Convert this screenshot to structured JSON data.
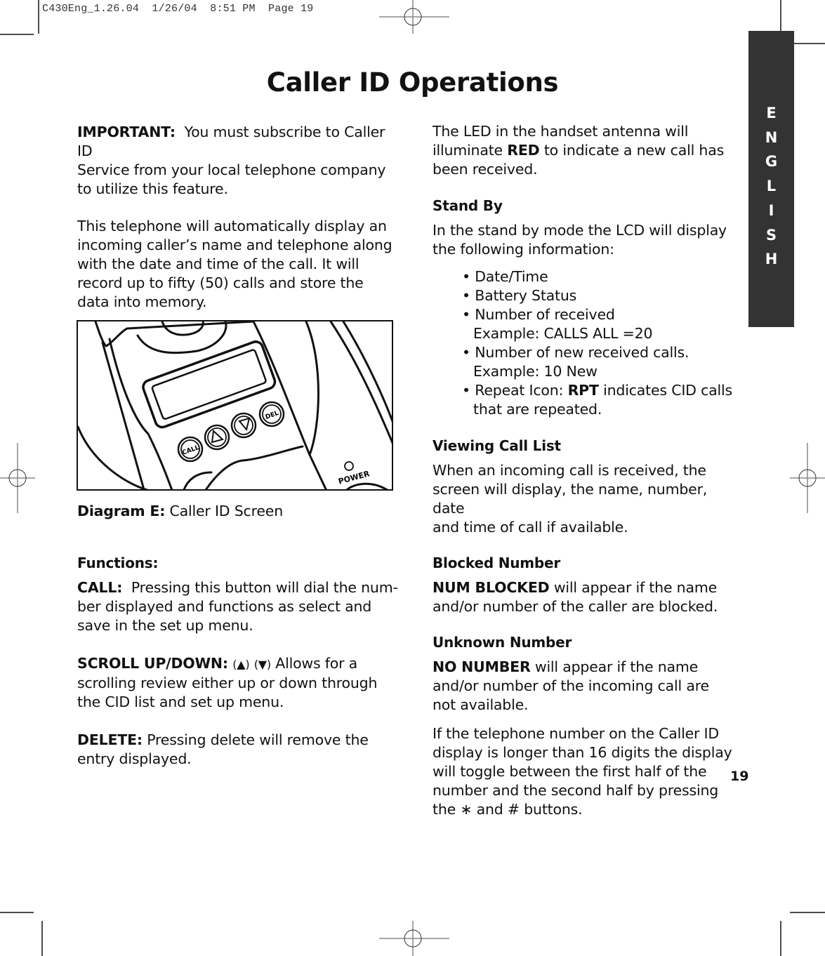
{
  "slug": "C430Eng_1.26.04  1/26/04  8:51 PM  Page 19",
  "title": "Caller ID Operations",
  "side_tab": {
    "letters": [
      "E",
      "N",
      "G",
      "L",
      "I",
      "S",
      "H"
    ],
    "color": "#333333"
  },
  "page_number": "19",
  "left_column": {
    "important": {
      "label": "IMPORTANT:",
      "lines": [
        "You must subscribe to Caller ID",
        "Service from your local telephone company",
        "to utilize this feature."
      ]
    },
    "intro_lines": [
      "This telephone will automatically display an",
      "incoming caller’s name and telephone along",
      "with the date and time of the call. It will",
      "record up to fifty (50) calls and store the",
      "data into memory."
    ],
    "diagram": {
      "button_labels": {
        "call": "CALL",
        "del": "DEL",
        "power": "POWER"
      },
      "caption_label": "Diagram E:",
      "caption_text": "Caller ID Screen"
    },
    "functions_heading": "Functions:",
    "call": {
      "label": "CALL:",
      "lines": [
        "Pressing this button will dial the num-",
        "ber displayed and functions as select and",
        "save in the set up menu."
      ]
    },
    "scroll": {
      "label": "SCROLL UP/DOWN:",
      "up_symbol": "(▲)",
      "down_symbol": "(▼)",
      "lines": [
        "Allows for a",
        "scrolling review either up or down through",
        "the CID list and set up menu."
      ]
    },
    "delete": {
      "label": "DELETE:",
      "lines": [
        "Pressing delete will remove the",
        "entry displayed."
      ]
    }
  },
  "right_column": {
    "led": {
      "line1": "The LED in the handset antenna will",
      "line2_before": "illuminate",
      "line2_bold": "RED",
      "line2_after": "to indicate a new call has",
      "line3": "been received."
    },
    "standby": {
      "heading": "Stand By",
      "lines": [
        "In the stand by mode the LCD will display",
        "the following information:"
      ],
      "bullets": [
        {
          "text": "Date/Time"
        },
        {
          "text": "Battery Status"
        },
        {
          "text": "Number of received",
          "sub": "Example: CALLS ALL =20"
        },
        {
          "text": "Number of new received calls.",
          "sub": "Example: 10 New"
        },
        {
          "text_before": "Repeat Icon:",
          "bold": "RPT",
          "text_after": "indicates CID calls",
          "sub": "that are repeated."
        }
      ]
    },
    "viewing": {
      "heading": "Viewing Call List",
      "lines": [
        "When an incoming call is received, the",
        "screen will display, the name, number, date",
        "and time of call if available."
      ]
    },
    "blocked": {
      "heading": "Blocked Number",
      "bold": "NUM BLOCKED",
      "line1_after": "will appear if the name",
      "line2": "and/or number of the caller are blocked."
    },
    "unknown": {
      "heading": "Unknown Number",
      "bold": "NO NUMBER",
      "line1_after": "will appear if the name",
      "lines": [
        "and/or number of the incoming call are",
        "not available."
      ]
    },
    "toggle_lines": [
      "If the telephone number on the Caller ID",
      "display is longer than 16 digits the display",
      "will toggle between the first half of the",
      "number and the second half by pressing",
      "the ∗ and # buttons."
    ]
  }
}
